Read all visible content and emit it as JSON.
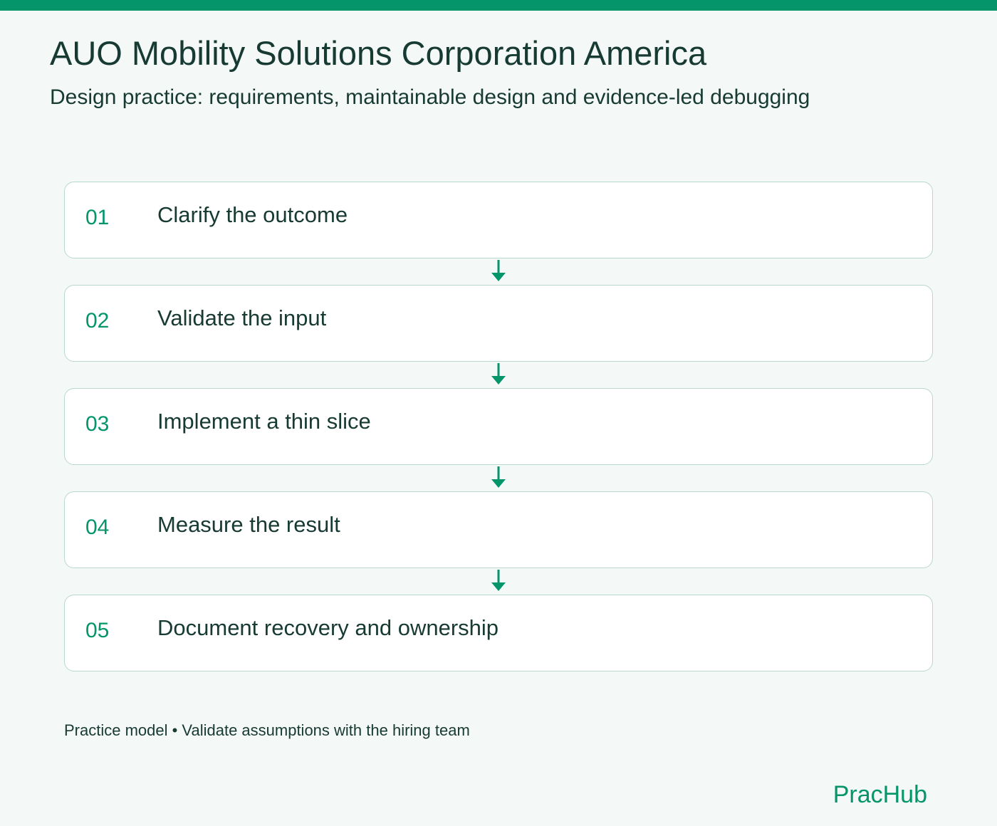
{
  "header": {
    "title": "AUO Mobility Solutions Corporation America",
    "subtitle": "Design practice: requirements, maintainable design and evidence-led debugging"
  },
  "steps": [
    {
      "number": "01",
      "label": "Clarify the outcome"
    },
    {
      "number": "02",
      "label": "Validate the input"
    },
    {
      "number": "03",
      "label": "Implement a thin slice"
    },
    {
      "number": "04",
      "label": "Measure the result"
    },
    {
      "number": "05",
      "label": "Document recovery and ownership"
    }
  ],
  "footer": {
    "note": "Practice model • Validate assumptions with the hiring team",
    "brand": "PracHub"
  },
  "colors": {
    "accent": "#04956a",
    "text": "#173a33",
    "background": "#f4f8f6",
    "card_border": "#b9d8cc"
  },
  "icons": {
    "connector": "arrow-down-icon"
  }
}
